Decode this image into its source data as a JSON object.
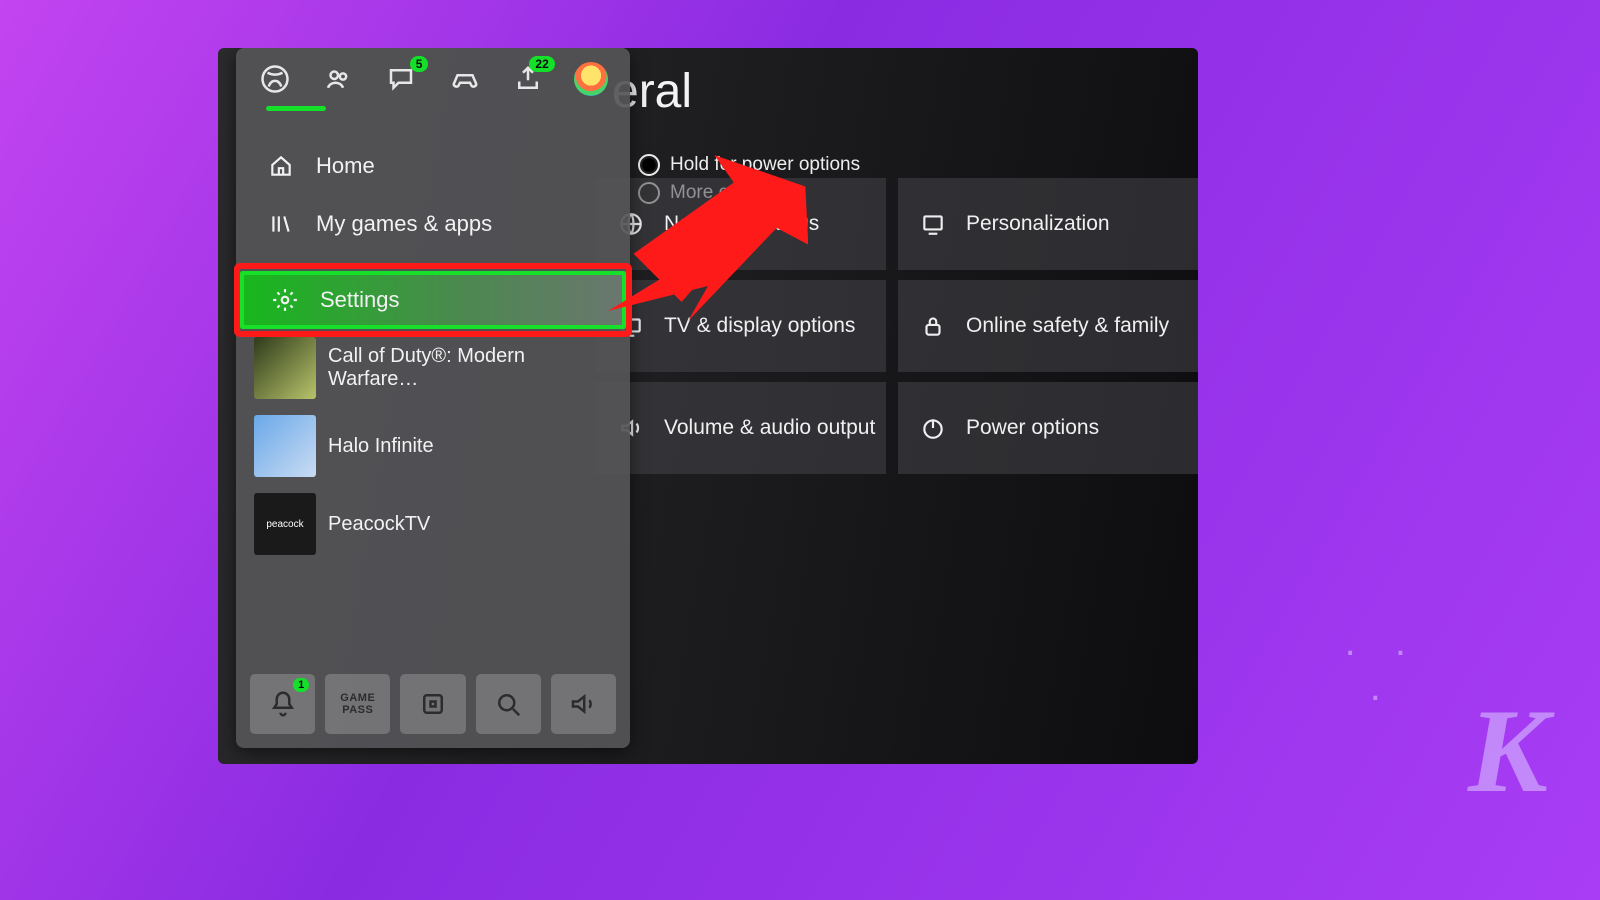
{
  "page_title": "eral",
  "hints": {
    "power": "Hold for power options",
    "more": "More options"
  },
  "tiles": {
    "network": "Network settings",
    "personalization": "Personalization",
    "tv": "TV & display options",
    "safety": "Online safety & family",
    "audio": "Volume & audio output",
    "power": "Power options"
  },
  "tabs": {
    "chat_badge": "5",
    "share_badge": "22"
  },
  "menu": {
    "home": "Home",
    "games": "My games & apps",
    "settings": "Settings"
  },
  "apps": [
    {
      "label": "Call of Duty®: Modern Warfare…",
      "colors": "linear-gradient(135deg,#2e3a1a,#b8c46a)"
    },
    {
      "label": "Halo Infinite",
      "colors": "linear-gradient(135deg,#6aa8e8,#c9dcf3)"
    },
    {
      "label": "PeacockTV",
      "colors": "#1a1a1a",
      "text": "peacock"
    }
  ],
  "bottom": {
    "notif_badge": "1",
    "gamepass": "GAME\nPASS"
  },
  "watermark": "K"
}
